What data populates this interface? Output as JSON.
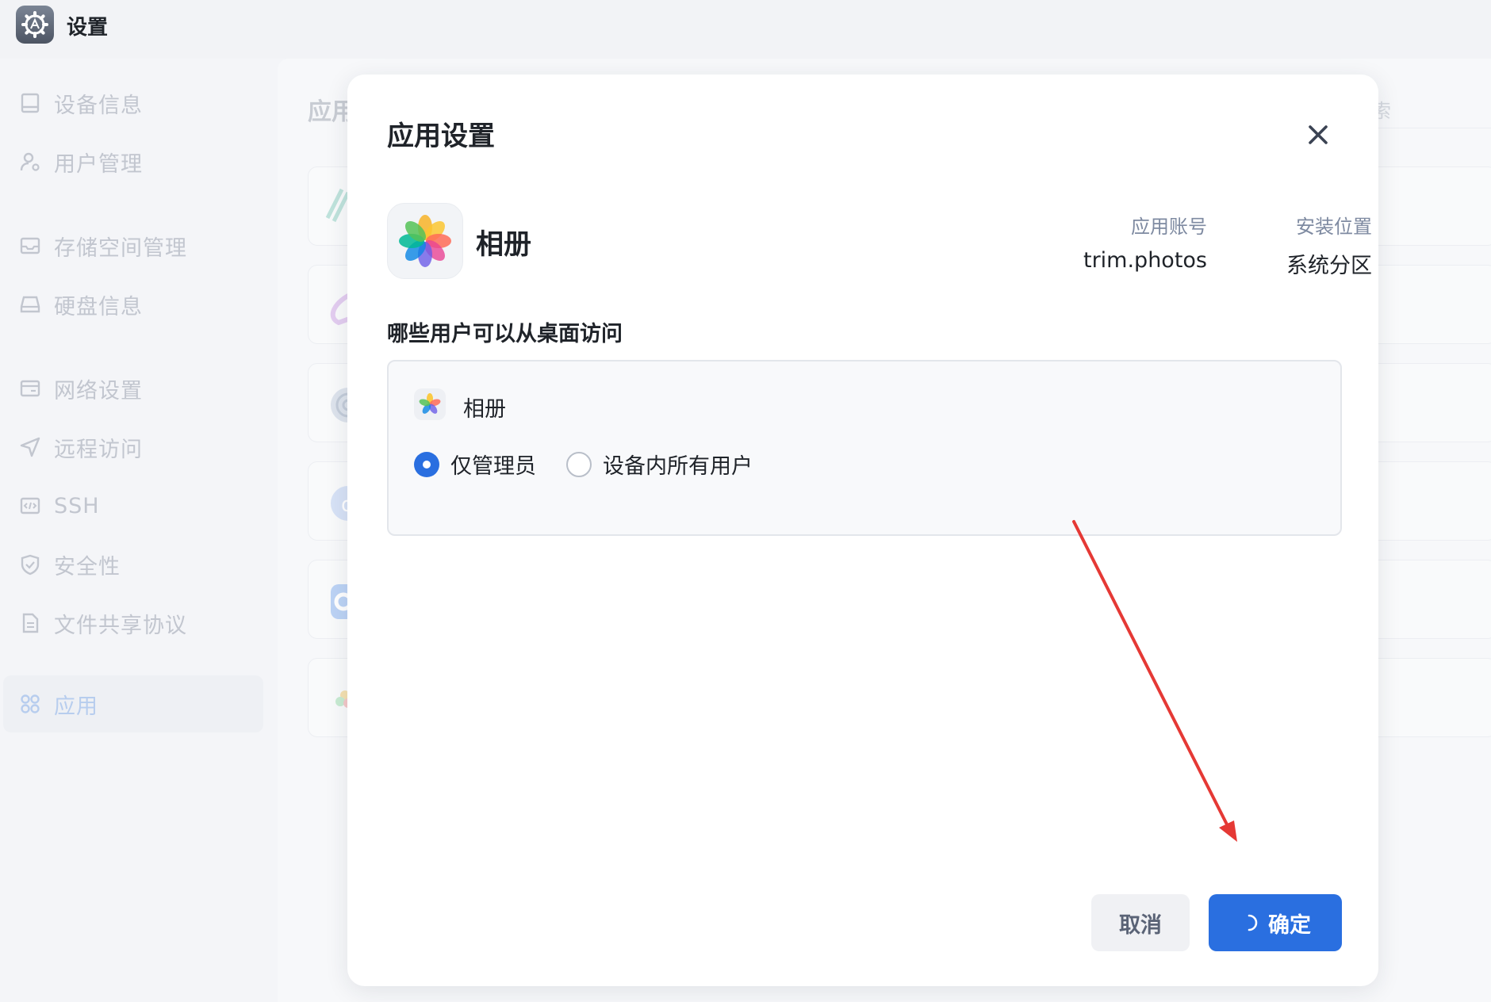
{
  "window": {
    "title": "设置",
    "icon": "settings-gear-icon"
  },
  "sidebar": {
    "items": [
      {
        "label": "设备信息",
        "icon": "device-icon",
        "active": false
      },
      {
        "label": "用户管理",
        "icon": "user-gear-icon",
        "active": false
      },
      {
        "label": "存储空间管理",
        "icon": "storage-icon",
        "active": false
      },
      {
        "label": "硬盘信息",
        "icon": "disk-icon",
        "active": false
      },
      {
        "label": "网络设置",
        "icon": "network-icon",
        "active": false
      },
      {
        "label": "远程访问",
        "icon": "send-icon",
        "active": false
      },
      {
        "label": "SSH",
        "icon": "code-icon",
        "active": false
      },
      {
        "label": "安全性",
        "icon": "shield-icon",
        "active": false
      },
      {
        "label": "文件共享协议",
        "icon": "file-icon",
        "active": false
      },
      {
        "label": "应用",
        "icon": "apps-icon",
        "active": true
      }
    ]
  },
  "main": {
    "heading": "应用",
    "search_placeholder": "索"
  },
  "dialog": {
    "title": "应用设置",
    "app_name": "相册",
    "account_label": "应用账号",
    "account_value": "trim.photos",
    "location_label": "安装位置",
    "location_value": "系统分区",
    "section_title": "哪些用户可以从桌面访问",
    "entry_name": "相册",
    "options": [
      {
        "label": "仅管理员",
        "checked": true
      },
      {
        "label": "设备内所有用户",
        "checked": false
      }
    ],
    "cancel_label": "取消",
    "ok_label": "确定"
  },
  "colors": {
    "accent": "#2a6fe0",
    "annotation": "#e53935"
  }
}
